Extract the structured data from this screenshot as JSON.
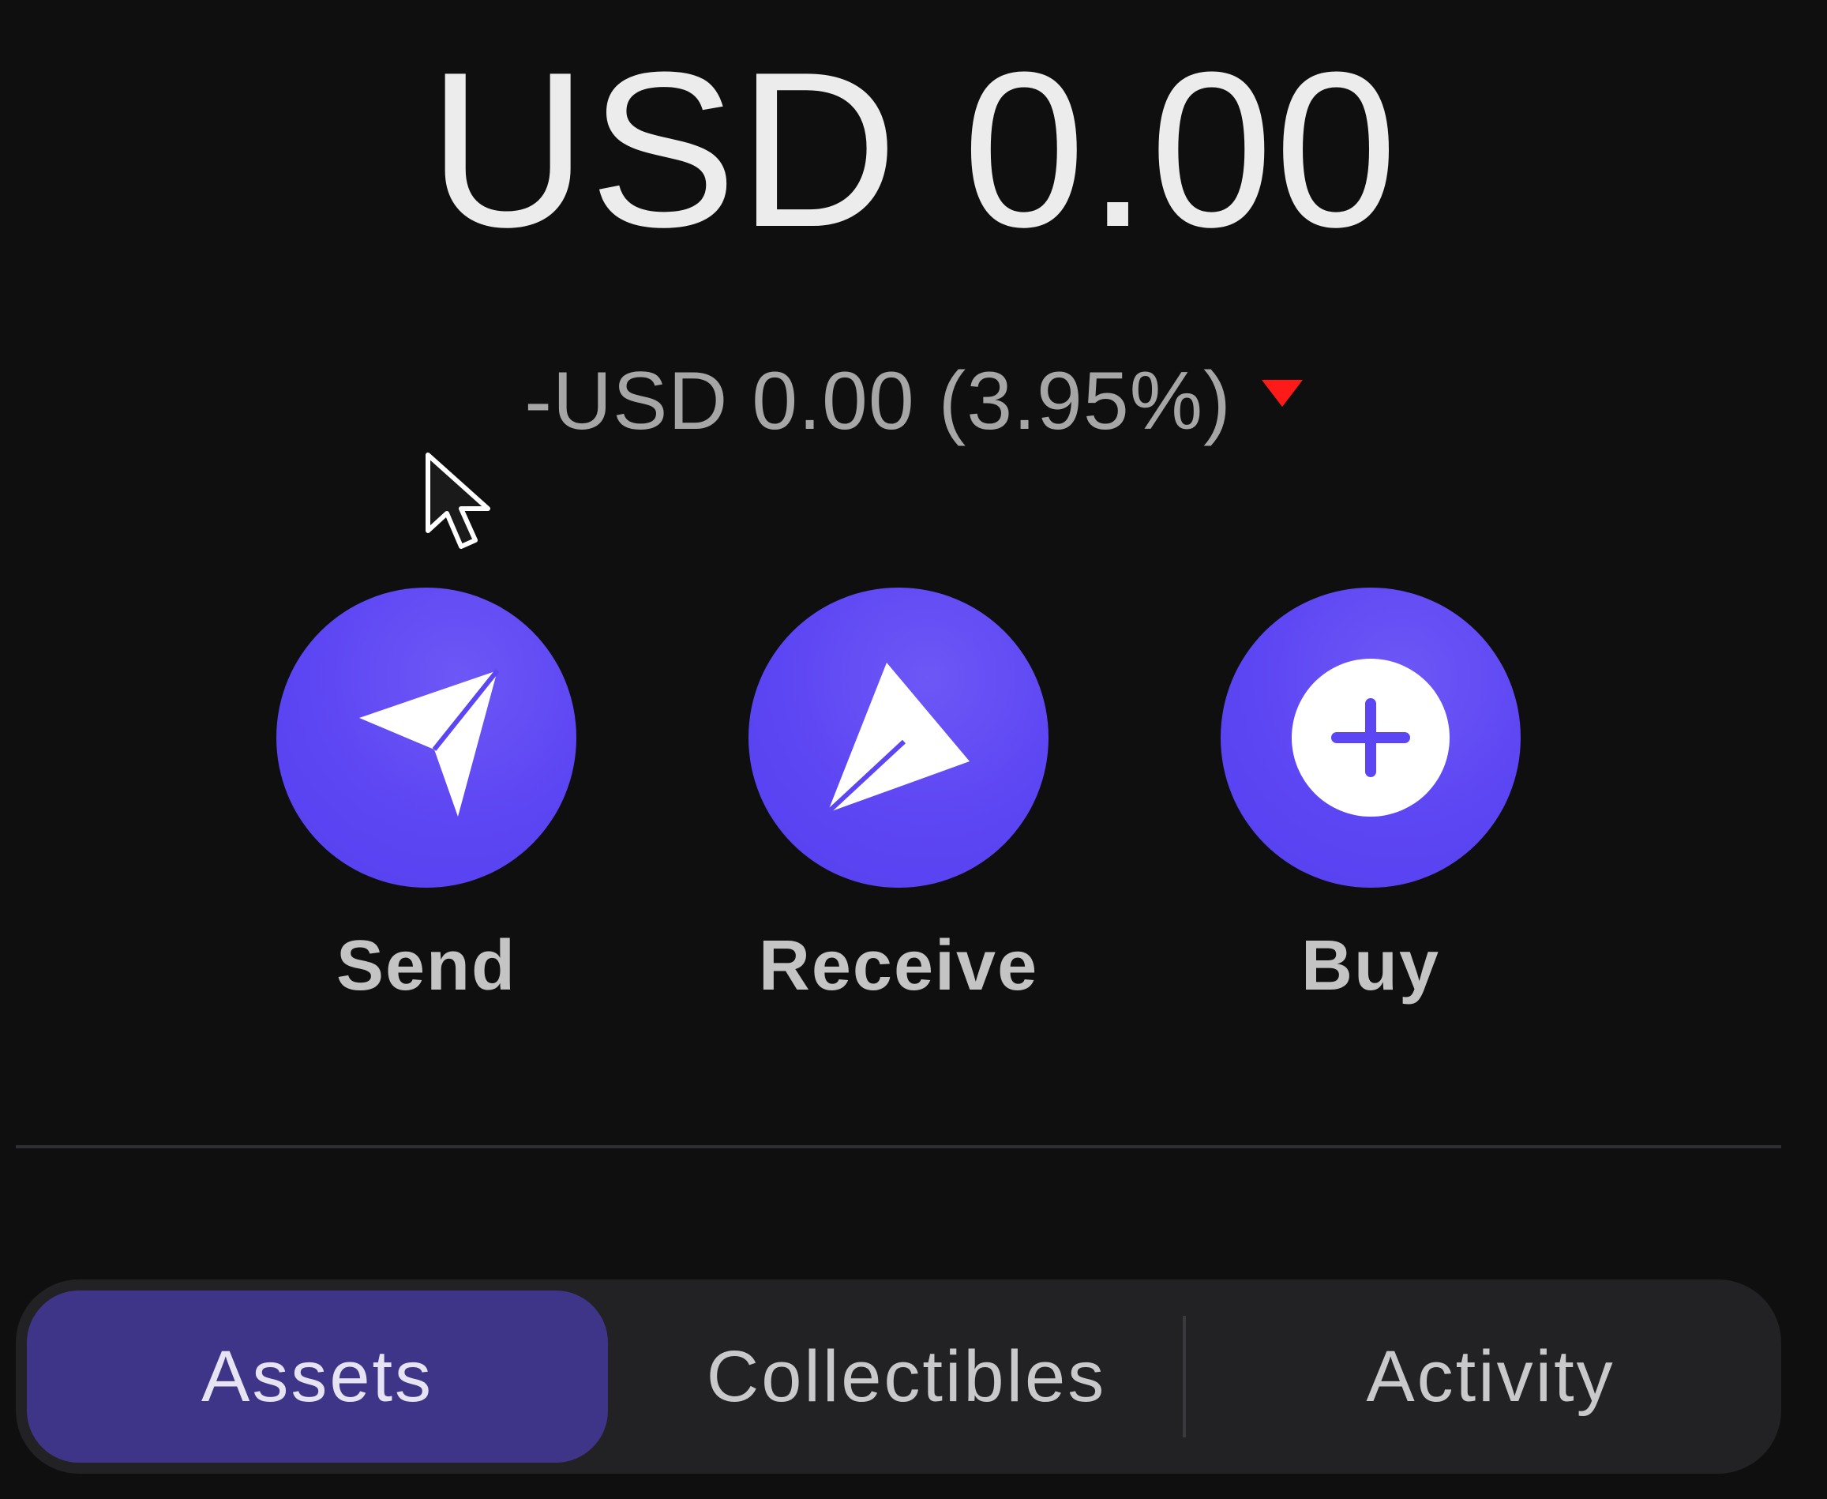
{
  "balance": {
    "amount_text": "USD 0.00",
    "change_text": "-USD 0.00 (3.95%)",
    "change_direction": "down",
    "change_color": "#ff1a1a"
  },
  "actions": [
    {
      "label": "Send",
      "icon": "send-icon"
    },
    {
      "label": "Receive",
      "icon": "receive-icon"
    },
    {
      "label": "Buy",
      "icon": "plus-circle-icon"
    }
  ],
  "tabs": [
    {
      "label": "Assets",
      "selected": true
    },
    {
      "label": "Collectibles",
      "selected": false
    },
    {
      "label": "Activity",
      "selected": false
    }
  ],
  "colors": {
    "background": "#0f0f10",
    "accent": "#5c45f3",
    "selected_tab": "#3e3588",
    "tab_bar": "#222225"
  }
}
